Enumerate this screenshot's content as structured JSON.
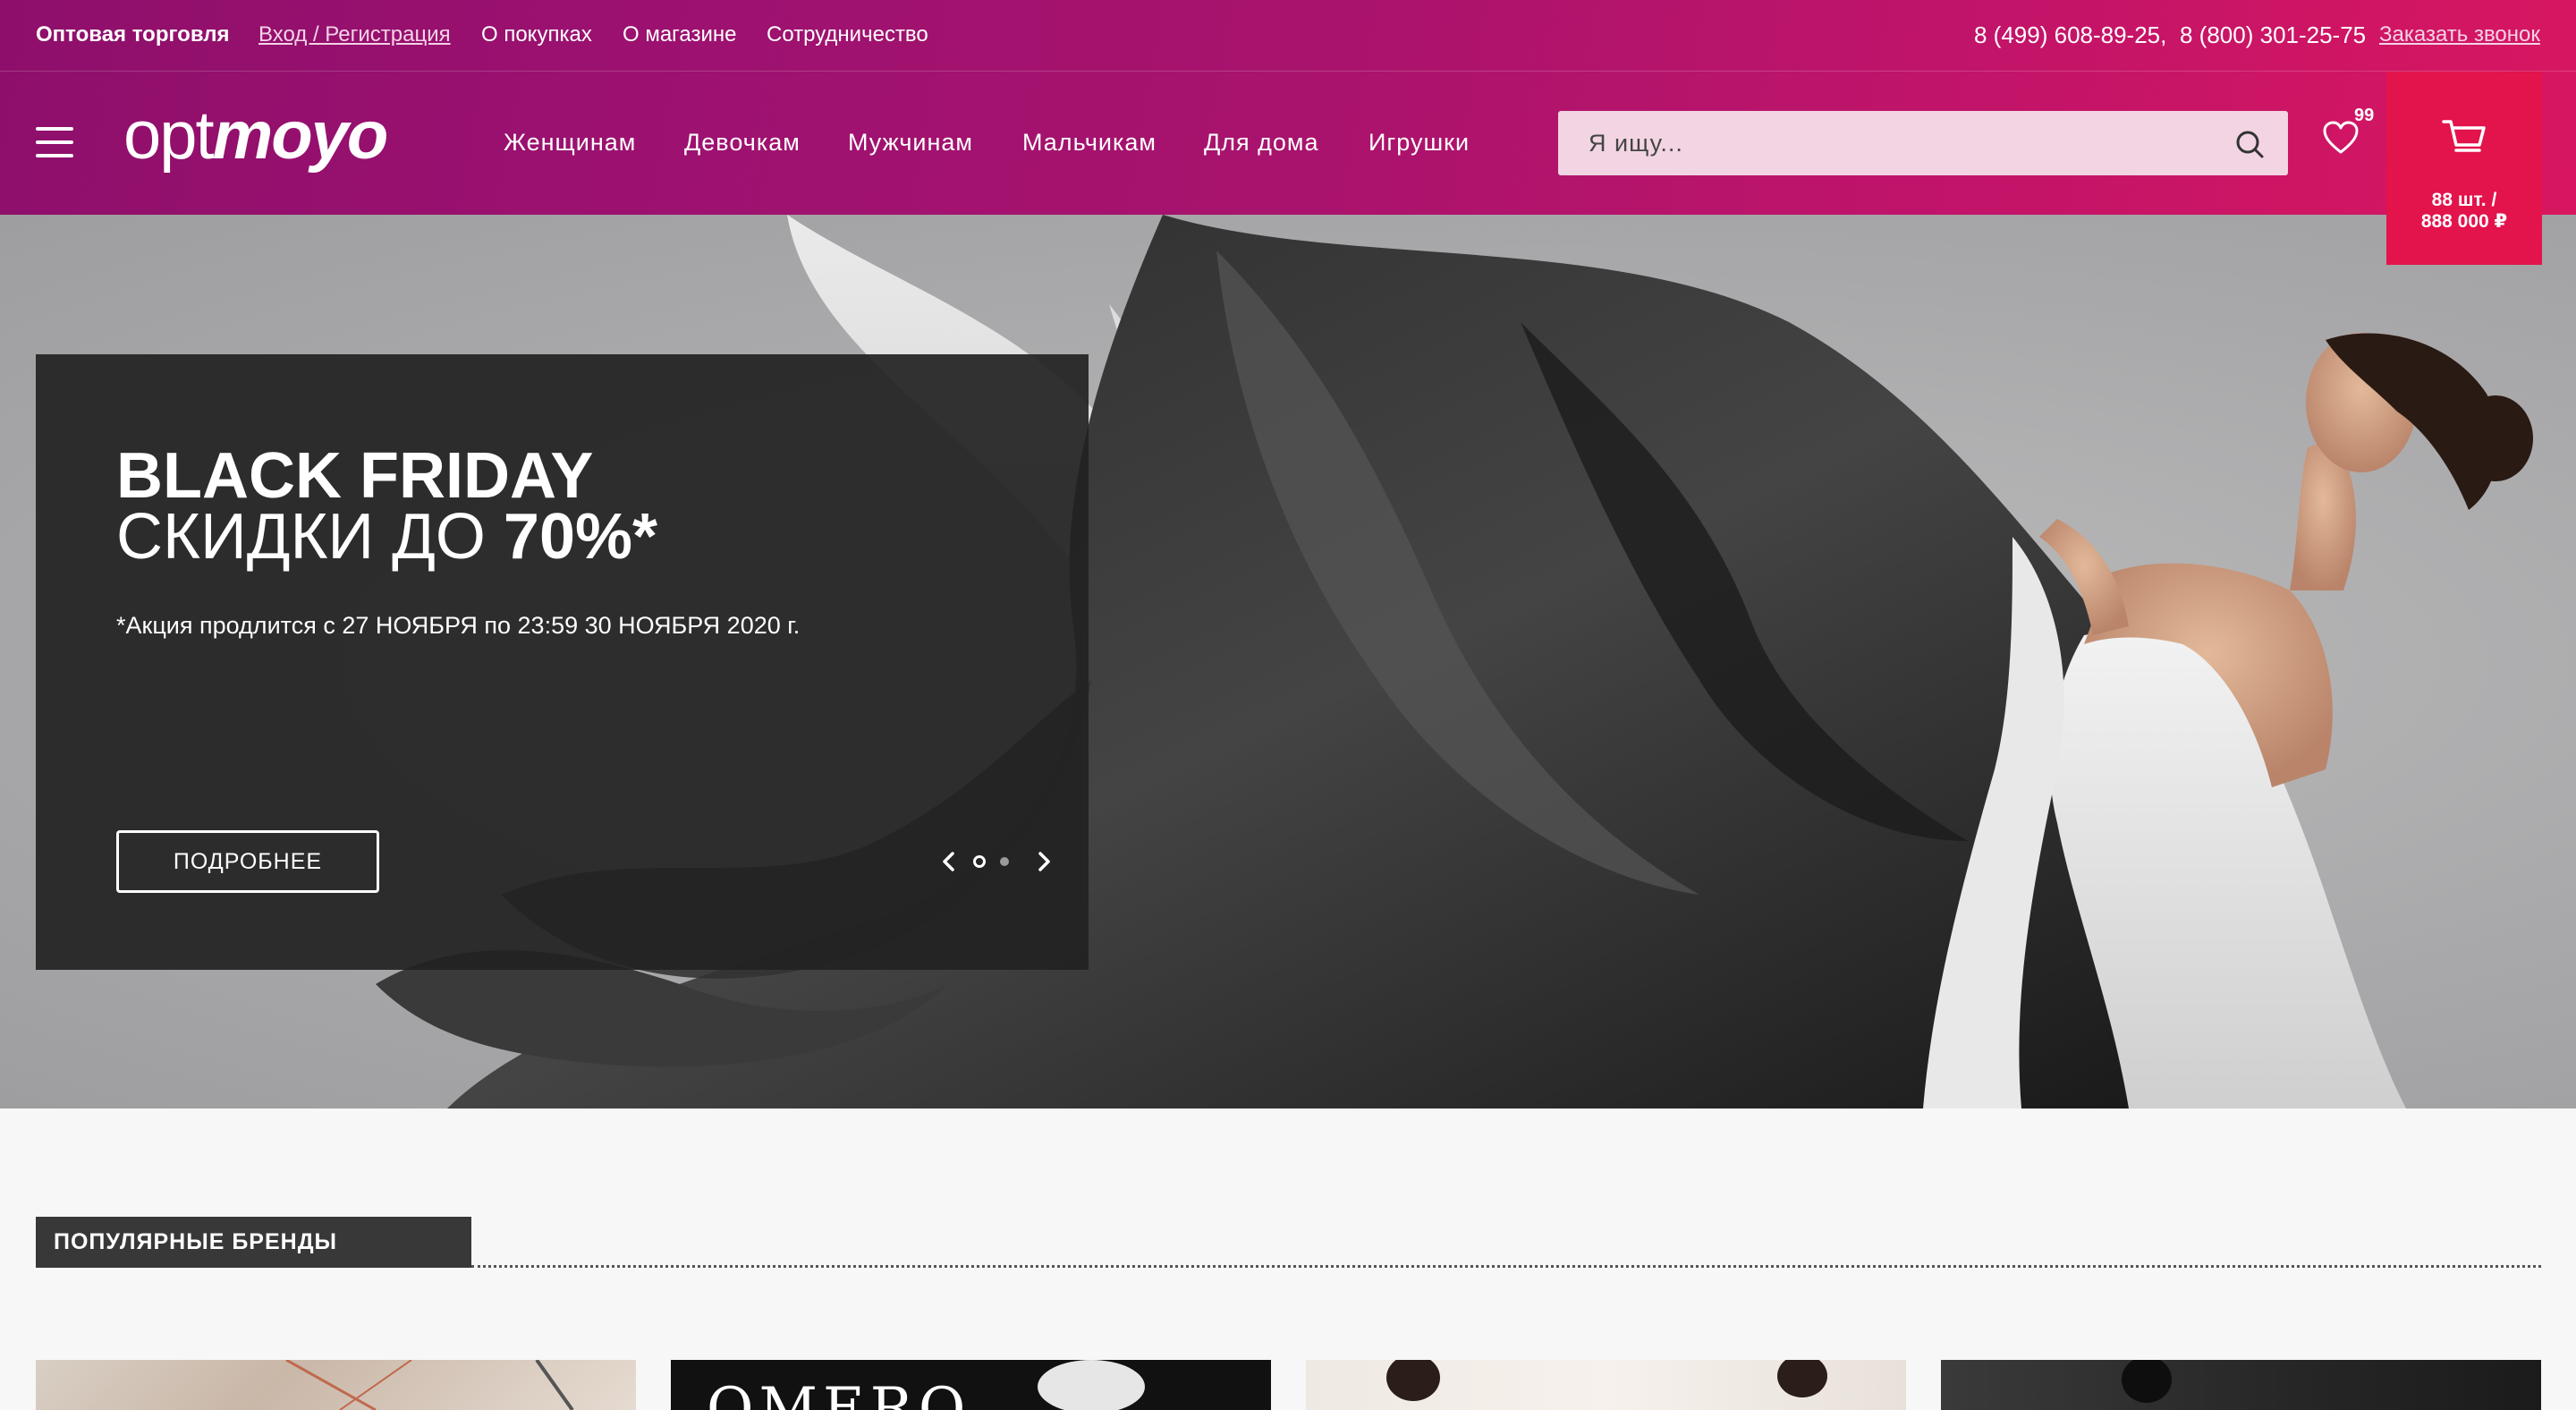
{
  "topbar": {
    "title": "Оптовая торговля",
    "login": "Вход / Регистрация",
    "links": [
      "О покупках",
      "О магазине",
      "Сотрудничество"
    ],
    "phone1": "8 (499) 608-89-25,",
    "phone2": "8 (800) 301-25-75",
    "callback": "Заказать звонок"
  },
  "logo": {
    "part1": "opt",
    "part2": "moyo"
  },
  "nav": [
    "Женщинам",
    "Девочкам",
    "Мужчинам",
    "Мальчикам",
    "Для дома",
    "Игрушки"
  ],
  "search": {
    "placeholder": "Я ищу..."
  },
  "favorites": {
    "count": "99"
  },
  "cart": {
    "summary_line1": "88 шт. /",
    "summary_line2": "888 000 ₽"
  },
  "hero": {
    "title": "BLACK FRIDAY",
    "subtitle_prefix": "СКИДКИ ДО ",
    "subtitle_value": "70%*",
    "note": "*Акция продлится с 27 НОЯБРЯ по 23:59 30 НОЯБРЯ 2020 г.",
    "button": "ПОДРОБНЕЕ",
    "slides_total": 2,
    "active_slide": 1
  },
  "brands": {
    "heading": "ПОПУЛЯРНЫЕ БРЕНДЫ",
    "card2_text": "OMERO"
  },
  "colors": {
    "header_gradient_start": "#8e0f6b",
    "header_gradient_end": "#d81660",
    "cart_bg": "#e3134b",
    "promo_bg": "#222222"
  }
}
